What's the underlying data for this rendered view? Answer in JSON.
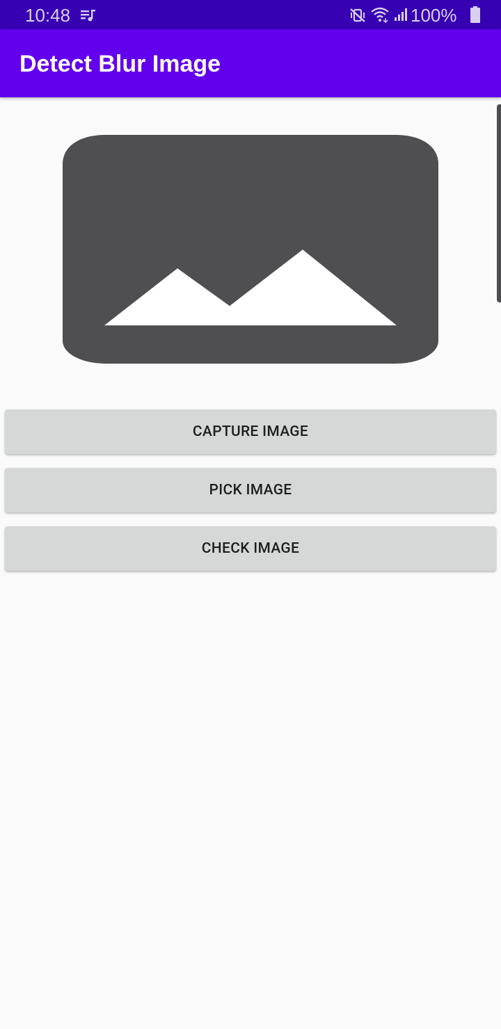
{
  "status_bar": {
    "time": "10:48",
    "battery": "100%",
    "icons": [
      "music-queue-icon",
      "vibrate-mute-icon",
      "wifi-icon",
      "signal-icon",
      "battery-icon"
    ]
  },
  "app_bar": {
    "title": "Detect Blur Image"
  },
  "preview": {
    "icon": "image-placeholder-icon",
    "color": "#4F4F51"
  },
  "buttons": {
    "capture": "CAPTURE IMAGE",
    "pick": "PICK IMAGE",
    "check": "CHECK IMAGE"
  },
  "colors": {
    "status_bar": "#3700B3",
    "app_bar": "#6200EE",
    "background": "#FAFAFA",
    "button": "#D6D7D7",
    "button_text": "#1F1F1F"
  }
}
